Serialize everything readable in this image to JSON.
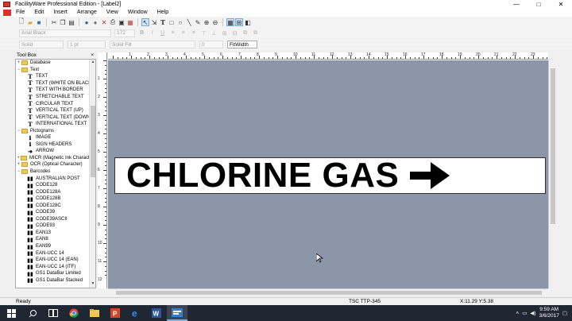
{
  "window": {
    "title": "FacilityWare Professional Edition - [Label2]",
    "controls": [
      "—",
      "□",
      "✕"
    ]
  },
  "menu": {
    "items": [
      "File",
      "Edit",
      "Insert",
      "Arrange",
      "View",
      "Window",
      "Help"
    ]
  },
  "toolbar2": {
    "font_name": "Arial Black",
    "font_size": "172",
    "bold": "B",
    "italic": "I",
    "underline": "U"
  },
  "toolbar3": {
    "line_style": "Solid",
    "line_width": "1 pt",
    "fill": "Solid Fill",
    "rotation": "0",
    "zoom": "FitWidth"
  },
  "toolbox": {
    "title": "Tool Box",
    "close": "×",
    "items": [
      {
        "kind": "folder",
        "label": "Database",
        "expander": "+"
      },
      {
        "kind": "folder",
        "label": "Text",
        "expander": "−"
      },
      {
        "kind": "tool",
        "glyph": "T",
        "label": "TEXT"
      },
      {
        "kind": "tool",
        "glyph": "T",
        "label": "TEXT (WHITE ON BLACK)"
      },
      {
        "kind": "tool",
        "glyph": "T",
        "label": "TEXT WITH BORDER"
      },
      {
        "kind": "tool",
        "glyph": "T",
        "label": "STRETCHABLE TEXT"
      },
      {
        "kind": "tool",
        "glyph": "T",
        "label": "CIRCULAR TEXT"
      },
      {
        "kind": "tool",
        "glyph": "T",
        "label": "VERTICAL TEXT (UP)"
      },
      {
        "kind": "tool",
        "glyph": "T",
        "label": "VERTICAL TEXT (DOWN)"
      },
      {
        "kind": "tool",
        "glyph": "T",
        "label": "INTERNATIONAL TEXT"
      },
      {
        "kind": "folder",
        "label": "Pictograms",
        "expander": "−"
      },
      {
        "kind": "tool",
        "glyph": "ℹ",
        "label": "IMAGE"
      },
      {
        "kind": "tool",
        "glyph": "ℹ",
        "label": "SIGN HEADERS"
      },
      {
        "kind": "tool",
        "glyph": "➜",
        "label": "ARROW"
      },
      {
        "kind": "folder",
        "label": "MICR (Magnetic Ink Character)",
        "expander": "+"
      },
      {
        "kind": "folder",
        "label": "OCR (Optical Character)",
        "expander": "+"
      },
      {
        "kind": "folder",
        "label": "Barcodes",
        "expander": "−"
      },
      {
        "kind": "tool",
        "glyph": "▮▮",
        "label": "AUSTRALIAN POST"
      },
      {
        "kind": "tool",
        "glyph": "▮▮",
        "label": "CODE128"
      },
      {
        "kind": "tool",
        "glyph": "▮▮",
        "label": "CODE128A"
      },
      {
        "kind": "tool",
        "glyph": "▮▮",
        "label": "CODE128B"
      },
      {
        "kind": "tool",
        "glyph": "▮▮",
        "label": "CODE128C"
      },
      {
        "kind": "tool",
        "glyph": "▮▮",
        "label": "CODE39"
      },
      {
        "kind": "tool",
        "glyph": "▮▮",
        "label": "CODE39ASCII"
      },
      {
        "kind": "tool",
        "glyph": "▮▮",
        "label": "CODE93"
      },
      {
        "kind": "tool",
        "glyph": "▮▮",
        "label": "EAN13"
      },
      {
        "kind": "tool",
        "glyph": "▮▮",
        "label": "EAN8"
      },
      {
        "kind": "tool",
        "glyph": "▮▮",
        "label": "EAN99"
      },
      {
        "kind": "tool",
        "glyph": "▮▮",
        "label": "EAN-UCC 14"
      },
      {
        "kind": "tool",
        "glyph": "▮▮",
        "label": "EAN-UCC 14 (EAN)"
      },
      {
        "kind": "tool",
        "glyph": "▮▮",
        "label": "EAN-UCC 14 (ITF)"
      },
      {
        "kind": "tool",
        "glyph": "▮▮",
        "label": "GS1 DataBar Limited"
      },
      {
        "kind": "tool",
        "glyph": "▮▮",
        "label": "GS1 DataBar Stacked"
      }
    ]
  },
  "ruler": {
    "h_labels": [
      "1",
      "2",
      "3",
      "4",
      "5",
      "6",
      "7",
      "8",
      "9",
      "10",
      "11",
      "12",
      "13",
      "14",
      "15",
      "16",
      "17",
      "18",
      "19",
      "20",
      "21",
      "22",
      "23",
      "24"
    ],
    "v_labels": [
      "1",
      "2",
      "3",
      "4",
      "5",
      "6",
      "7",
      "8",
      "9",
      "10",
      "11",
      "12"
    ]
  },
  "label": {
    "text": "CHLORINE GAS",
    "background": "#ffffff",
    "text_color": "#000000"
  },
  "canvas": {
    "background": "#8b97a9"
  },
  "status": {
    "ready": "Ready",
    "printer": "TSC TTP-345",
    "coords": "X:11.29  Y:5.38"
  },
  "taskbar": {
    "time": "9:59 AM",
    "date": "3/6/2017",
    "apps": [
      "start-icon",
      "search-icon",
      "task-view-icon",
      "chrome-icon",
      "file-explorer-icon",
      "powerpoint-icon",
      "edge-icon",
      "word-icon",
      "facilityware-icon"
    ]
  }
}
